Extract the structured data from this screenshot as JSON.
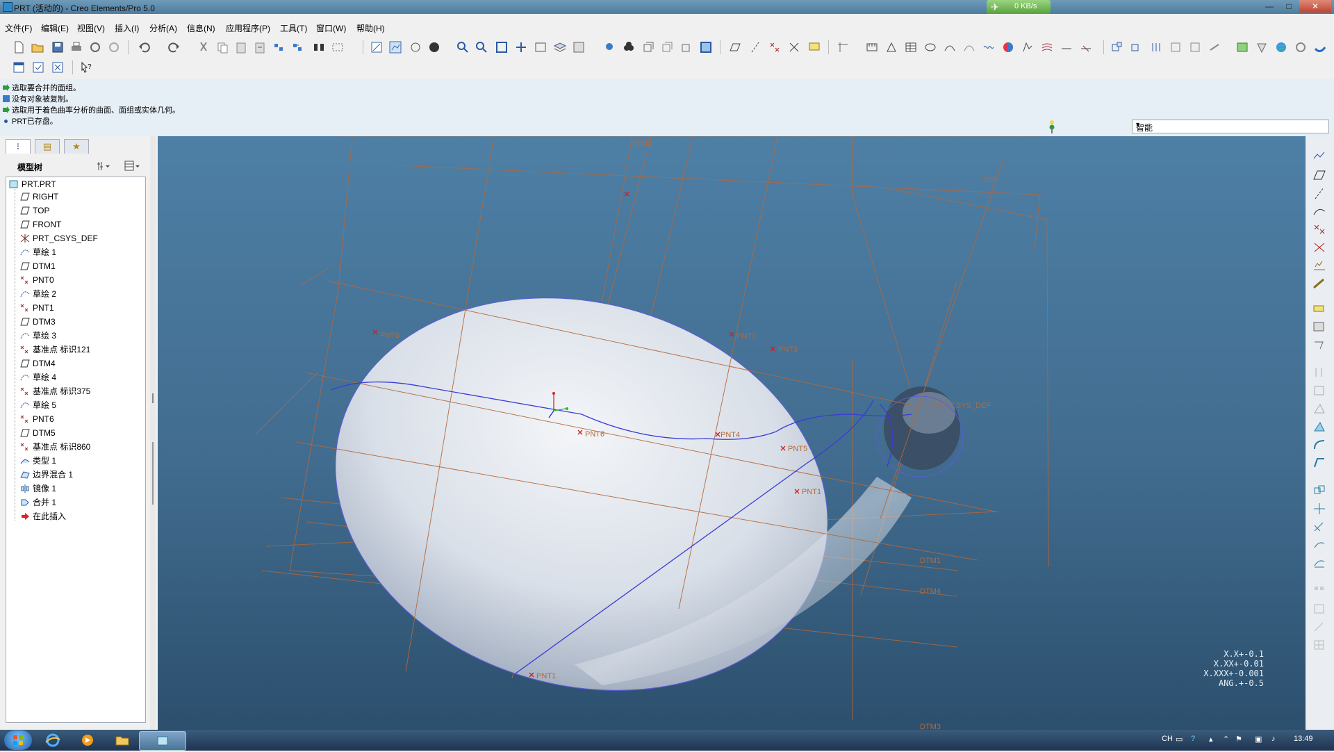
{
  "window": {
    "title": "PRT (活动的) - Creo Elements/Pro 5.0",
    "net_speed": "0 KB/s",
    "controls": [
      "—",
      "□",
      "✕"
    ]
  },
  "menu": [
    "文件(F)",
    "编辑(E)",
    "视图(V)",
    "插入(I)",
    "分析(A)",
    "信息(N)",
    "应用程序(P)",
    "工具(T)",
    "窗口(W)",
    "帮助(H)"
  ],
  "messages": [
    "选取要合并的面组。",
    "没有对象被复制。",
    "选取用于着色曲率分析的曲面、面组或实体几何。",
    "PRT已存盘。"
  ],
  "filter": {
    "selected": "智能"
  },
  "tree": {
    "title": "模型树",
    "root": "PRT.PRT",
    "items": [
      {
        "label": "RIGHT",
        "icon": "datum-plane-icon"
      },
      {
        "label": "TOP",
        "icon": "datum-plane-icon"
      },
      {
        "label": "FRONT",
        "icon": "datum-plane-icon"
      },
      {
        "label": "PRT_CSYS_DEF",
        "icon": "csys-icon"
      },
      {
        "label": "草绘 1",
        "icon": "sketch-icon"
      },
      {
        "label": "DTM1",
        "icon": "datum-plane-icon"
      },
      {
        "label": "PNT0",
        "icon": "datum-point-icon"
      },
      {
        "label": "草绘 2",
        "icon": "sketch-icon"
      },
      {
        "label": "PNT1",
        "icon": "datum-point-icon"
      },
      {
        "label": "DTM3",
        "icon": "datum-plane-icon"
      },
      {
        "label": "草绘 3",
        "icon": "sketch-icon"
      },
      {
        "label": "基准点 标识121",
        "icon": "datum-point-icon"
      },
      {
        "label": "DTM4",
        "icon": "datum-plane-icon"
      },
      {
        "label": "草绘 4",
        "icon": "sketch-icon"
      },
      {
        "label": "基准点 标识375",
        "icon": "datum-point-icon"
      },
      {
        "label": "草绘 5",
        "icon": "sketch-icon"
      },
      {
        "label": "PNT6",
        "icon": "datum-point-icon"
      },
      {
        "label": "DTM5",
        "icon": "datum-plane-icon"
      },
      {
        "label": "基准点 标识860",
        "icon": "datum-point-icon"
      },
      {
        "label": "类型 1",
        "icon": "style-icon"
      },
      {
        "label": "边界混合 1",
        "icon": "boundary-blend-icon"
      },
      {
        "label": "镜像 1",
        "icon": "mirror-icon"
      },
      {
        "label": "合并 1",
        "icon": "merge-icon"
      },
      {
        "label": "在此插入",
        "icon": "insert-here-arrow-icon"
      }
    ]
  },
  "viewport": {
    "labels": {
      "dtm5": "DTM5",
      "top": "TOP",
      "dtm1": "DTM1",
      "dtm4": "DTM4",
      "dtm3": "DTM3",
      "pnt_left": "PNT0",
      "pnt_center": "PNT6",
      "pnt_hole_left": "PNT4",
      "pnt_hole_top": "PNT2",
      "csys": "PRT_CSYS_DEF",
      "pnt_hole_right": "PNT3",
      "pnt_right_a": "PNT5",
      "pnt_right_b": "PNT1",
      "pnt_bottom": "PNT1"
    },
    "tolerances": [
      "X.X+-0.1",
      "X.XX+-0.01",
      "X.XXX+-0.001",
      "ANG.+-0.5"
    ]
  },
  "taskbar": {
    "lang": "CH",
    "clock": "13:49"
  },
  "colors": {
    "viewport_top": "#4e7fa5",
    "viewport_bottom": "#2c4f6d",
    "datum_plane": "#b4683a",
    "curve": "#3b3bd6",
    "point": "#cc2222"
  }
}
